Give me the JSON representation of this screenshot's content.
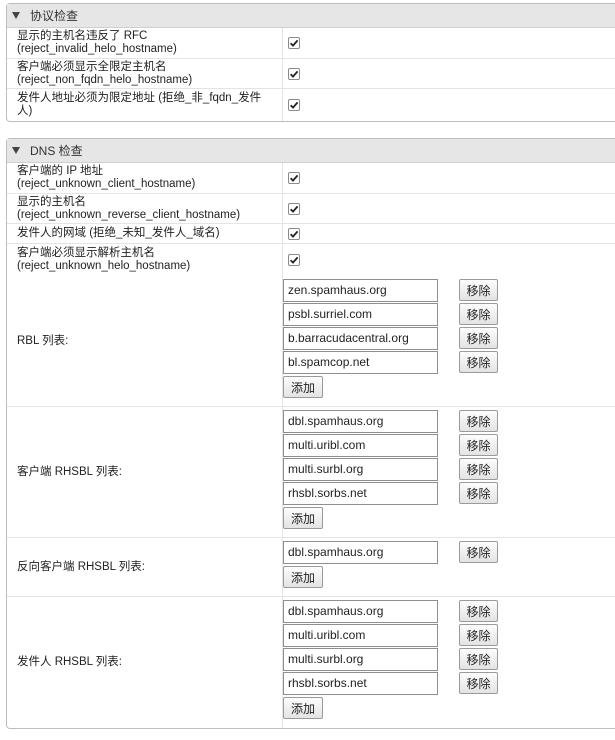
{
  "protocol_section": {
    "title": "协议检查",
    "rows": [
      {
        "label1": "显示的主机名违反了 RFC",
        "label2": "(reject_invalid_helo_hostname)",
        "checked": true
      },
      {
        "label1": "客户端必须显示全限定主机名",
        "label2": "(reject_non_fqdn_helo_hostname)",
        "checked": true
      },
      {
        "label1": "发件人地址必须为限定地址 (拒绝_非_fqdn_发件",
        "label2": "人)",
        "checked": true
      }
    ]
  },
  "dns_section": {
    "title": "DNS 检查",
    "rows": [
      {
        "label1": "客户端的 IP 地址",
        "label2": "(reject_unknown_client_hostname)",
        "checked": true
      },
      {
        "label1": "显示的主机名",
        "label2": "(reject_unknown_reverse_client_hostname)",
        "checked": true
      },
      {
        "label1": "发件人的网域 (拒绝_未知_发件人_域名)",
        "label2": "",
        "checked": true
      },
      {
        "label1": "客户端必须显示解析主机名",
        "label2": "(reject_unknown_helo_hostname)",
        "checked": true
      }
    ],
    "lists": [
      {
        "label": "RBL 列表:",
        "entries": [
          "zen.spamhaus.org",
          "psbl.surriel.com",
          "b.barracudacentral.org",
          "bl.spamcop.net"
        ]
      },
      {
        "label": "客户端 RHSBL 列表:",
        "entries": [
          "dbl.spamhaus.org",
          "multi.uribl.com",
          "multi.surbl.org",
          "rhsbl.sorbs.net"
        ]
      },
      {
        "label": "反向客户端 RHSBL 列表:",
        "entries": [
          "dbl.spamhaus.org"
        ]
      },
      {
        "label": "发件人 RHSBL 列表:",
        "entries": [
          "dbl.spamhaus.org",
          "multi.uribl.com",
          "multi.surbl.org",
          "rhsbl.sorbs.net"
        ]
      }
    ],
    "remove_label": "移除",
    "add_label": "添加"
  }
}
